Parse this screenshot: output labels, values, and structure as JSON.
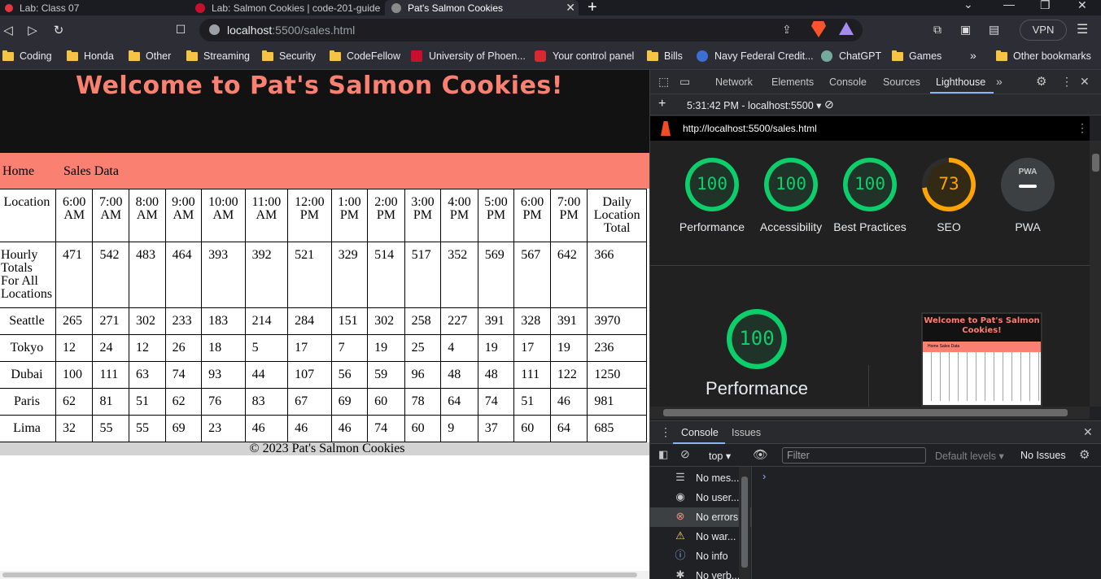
{
  "browser": {
    "tabs": [
      {
        "title": "Lab: Class 07"
      },
      {
        "title": "Lab: Salmon Cookies | code-201-guide"
      },
      {
        "title": "Pat's Salmon Cookies",
        "active": true
      }
    ],
    "url_host": "localhost",
    "url_rest": ":5500/sales.html",
    "vpn_label": "VPN",
    "bookmarks": [
      {
        "label": "Coding",
        "icon": "folder-icon"
      },
      {
        "label": "Honda",
        "icon": "folder-icon"
      },
      {
        "label": "Other",
        "icon": "folder-icon"
      },
      {
        "label": "Streaming",
        "icon": "folder-icon"
      },
      {
        "label": "Security",
        "icon": "folder-icon"
      },
      {
        "label": "CodeFellow",
        "icon": "folder-icon"
      },
      {
        "label": "University of Phoen...",
        "icon": "university-icon"
      },
      {
        "label": "Your control panel",
        "icon": "control-panel-icon"
      },
      {
        "label": "Bills",
        "icon": "folder-icon"
      },
      {
        "label": "Navy Federal Credit...",
        "icon": "globe-icon"
      },
      {
        "label": "ChatGPT",
        "icon": "chatgpt-icon"
      },
      {
        "label": "Games",
        "icon": "folder-icon"
      }
    ],
    "bookmarks_overflow": "»",
    "other_bookmarks": "Other bookmarks"
  },
  "page": {
    "title": "Welcome to Pat's Salmon Cookies!",
    "nav": {
      "home": "Home",
      "sales": "Sales Data"
    },
    "table": {
      "header": [
        "Location",
        "6:00 AM",
        "7:00 AM",
        "8:00 AM",
        "9:00 AM",
        "10:00 AM",
        "11:00 AM",
        "12:00 PM",
        "1:00 PM",
        "2:00 PM",
        "3:00 PM",
        "4:00 PM",
        "5:00 PM",
        "6:00 PM",
        "7:00 PM",
        "Daily Location Total"
      ],
      "totals_label": "Hourly Totals For All Locations",
      "totals": [
        "471",
        "542",
        "483",
        "464",
        "393",
        "392",
        "521",
        "329",
        "514",
        "517",
        "352",
        "569",
        "567",
        "642",
        "366"
      ],
      "rows": [
        {
          "city": "Seattle",
          "values": [
            "265",
            "271",
            "302",
            "233",
            "183",
            "214",
            "284",
            "151",
            "302",
            "258",
            "227",
            "391",
            "328",
            "391",
            "3970"
          ]
        },
        {
          "city": "Tokyo",
          "values": [
            "12",
            "24",
            "12",
            "26",
            "18",
            "5",
            "17",
            "7",
            "19",
            "25",
            "4",
            "19",
            "17",
            "19",
            "236"
          ]
        },
        {
          "city": "Dubai",
          "values": [
            "100",
            "111",
            "63",
            "74",
            "93",
            "44",
            "107",
            "56",
            "59",
            "96",
            "48",
            "48",
            "111",
            "122",
            "1250"
          ]
        },
        {
          "city": "Paris",
          "values": [
            "62",
            "81",
            "51",
            "62",
            "76",
            "83",
            "67",
            "69",
            "60",
            "78",
            "64",
            "74",
            "51",
            "46",
            "981"
          ]
        },
        {
          "city": "Lima",
          "values": [
            "32",
            "55",
            "55",
            "69",
            "23",
            "46",
            "46",
            "46",
            "74",
            "60",
            "9",
            "37",
            "60",
            "64",
            "685"
          ]
        }
      ]
    },
    "footer": "© 2023 Pat's Salmon Cookies"
  },
  "devtools": {
    "tabs": [
      "Network",
      "Elements",
      "Console",
      "Sources",
      "Lighthouse"
    ],
    "active_tab": "Lighthouse",
    "report_label": "5:31:42 PM - localhost:5500",
    "report_url": "http://localhost:5500/sales.html",
    "scores": [
      {
        "label": "Performance",
        "value": "100",
        "color": "#0cce6b"
      },
      {
        "label": "Accessibility",
        "value": "100",
        "color": "#0cce6b"
      },
      {
        "label": "Best Practices",
        "value": "100",
        "color": "#0cce6b"
      },
      {
        "label": "SEO",
        "value": "73",
        "color": "#ffa400"
      },
      {
        "label": "PWA",
        "value": "PWA",
        "color": "#9aa0a6"
      }
    ],
    "big_score": {
      "label": "Performance",
      "value": "100"
    },
    "thumb": {
      "title": "Welcome to Pat's Salmon Cookies!",
      "nav": "Home      Sales Data"
    },
    "drawer": {
      "tabs": [
        "Console",
        "Issues"
      ],
      "context": "top",
      "filter_placeholder": "Filter",
      "levels": "Default levels",
      "issues": "No Issues",
      "sidebar": [
        {
          "label": "No mes...",
          "icon": "list-icon"
        },
        {
          "label": "No user...",
          "icon": "user-icon"
        },
        {
          "label": "No errors",
          "icon": "error-icon",
          "selected": true
        },
        {
          "label": "No war...",
          "icon": "warning-icon"
        },
        {
          "label": "No info",
          "icon": "info-icon"
        },
        {
          "label": "No verb...",
          "icon": "bug-icon"
        }
      ]
    }
  }
}
